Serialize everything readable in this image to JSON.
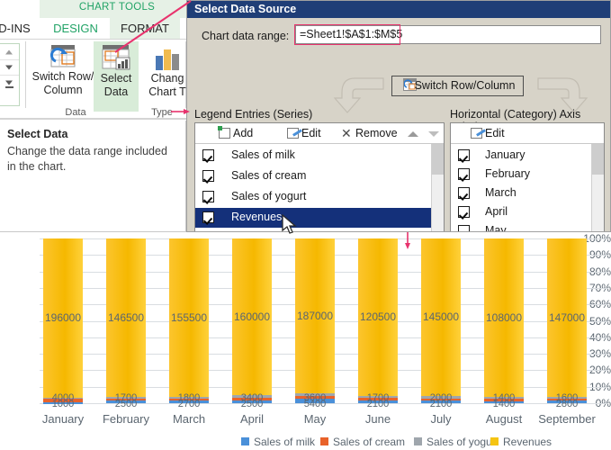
{
  "ribbon": {
    "contextual_title": "CHART TOOLS",
    "tabs": [
      {
        "label": "D-INS",
        "name": "tab-addins"
      },
      {
        "label": "DESIGN",
        "name": "tab-design"
      },
      {
        "label": "FORMAT",
        "name": "tab-format"
      }
    ],
    "buttons": [
      {
        "label": "Switch Row/\nColumn",
        "line1": "Switch Row/",
        "line2": "Column"
      },
      {
        "label": "Select Data",
        "line1": "Select",
        "line2": "Data"
      },
      {
        "label": "Change Chart Type",
        "line1": "Chang",
        "line2": "Chart T"
      }
    ],
    "groups": [
      {
        "label": "Data"
      },
      {
        "label": "Type"
      }
    ]
  },
  "tooltip": {
    "title": "Select Data",
    "body": "Change the data range included in the chart."
  },
  "dialog": {
    "title": "Select Data Source",
    "range_label": "Chart data range:",
    "range_value": "=Sheet1!$A$1:$M$5",
    "switch_button": "Switch Row/Column",
    "legend_section_label": "Legend Entries (Series)",
    "axis_section_label": "Horizontal (Category) Axis Labels",
    "legend_toolbar": [
      {
        "label": "Add",
        "icon": "add-table-icon"
      },
      {
        "label": "Edit",
        "icon": "edit-pencil-icon"
      },
      {
        "label": "Remove",
        "icon": "remove-x-icon"
      }
    ],
    "axis_toolbar": [
      {
        "label": "Edit",
        "icon": "edit-pencil-icon"
      }
    ],
    "legend_entries": [
      {
        "label": "Sales of milk",
        "checked": true,
        "selected": false
      },
      {
        "label": "Sales of cream",
        "checked": true,
        "selected": false
      },
      {
        "label": "Sales of yogurt",
        "checked": true,
        "selected": false
      },
      {
        "label": "Revenues",
        "checked": true,
        "selected": true
      }
    ],
    "axis_labels": [
      {
        "label": "January",
        "checked": true
      },
      {
        "label": "February",
        "checked": true
      },
      {
        "label": "March",
        "checked": true
      },
      {
        "label": "April",
        "checked": true
      },
      {
        "label": "May",
        "checked": true
      }
    ]
  },
  "chart_data": {
    "type": "bar",
    "subtype": "100% stacked column",
    "title": "",
    "xlabel": "",
    "ylabel": "",
    "ylim": [
      0,
      100
    ],
    "ytick_labels": [
      "100%",
      "90%",
      "80%",
      "70%",
      "60%",
      "50%",
      "40%",
      "30%",
      "20%",
      "10%",
      "0%"
    ],
    "grid": true,
    "legend_position": "bottom",
    "categories": [
      "January",
      "February",
      "March",
      "April",
      "May",
      "June",
      "July",
      "August",
      "September"
    ],
    "series": [
      {
        "name": "Sales of milk",
        "color": "#4a90d9",
        "values": [
          1000,
          2500,
          2700,
          2500,
          5400,
          2100,
          2100,
          1400,
          2800
        ]
      },
      {
        "name": "Sales of cream",
        "color": "#e8622a",
        "values": [
          4000,
          1700,
          1800,
          3400,
          3600,
          1700,
          2000,
          1400,
          1600
        ]
      },
      {
        "name": "Sales of yogurt",
        "color": "#9fa6ad",
        "values": [
          1800,
          1200,
          1900,
          2400,
          3000,
          1800,
          2800,
          1400,
          1800
        ]
      },
      {
        "name": "Revenues",
        "color": "#f5b800",
        "values": [
          196000,
          146500,
          155500,
          160000,
          187000,
          120500,
          145000,
          108000,
          147000
        ]
      }
    ],
    "revenue_data_labels": [
      "196000",
      "146500",
      "155500",
      "160000",
      "187000",
      "120500",
      "145000",
      "108000",
      "147000"
    ],
    "small_data_labels": [
      {
        "top": "4000",
        "bottom": "1000"
      },
      {
        "top": "1700",
        "bottom": "2500"
      },
      {
        "top": "1800",
        "bottom": "2700"
      },
      {
        "top": "3400",
        "bottom": "2500"
      },
      {
        "top": "3600",
        "bottom": "5400"
      },
      {
        "top": "1700",
        "bottom": "2100"
      },
      {
        "top": "2000",
        "bottom": "2100"
      },
      {
        "top": "1400",
        "bottom": "1400"
      },
      {
        "top": "1600",
        "bottom": "2800"
      }
    ],
    "legend_entries": [
      {
        "label": "Sales of milk",
        "color": "#4a90d9"
      },
      {
        "label": "Sales of cream",
        "color": "#e8622a"
      },
      {
        "label": "Sales of yogurt",
        "color": "#9fa6ad"
      },
      {
        "label": "Revenues",
        "color": "#f5c412"
      }
    ]
  },
  "colors": {
    "accent_green": "#21a366",
    "annotation_pink": "#e8336d",
    "dialog_title_bg": "#1f3e77",
    "selection_bg": "#14307a"
  }
}
